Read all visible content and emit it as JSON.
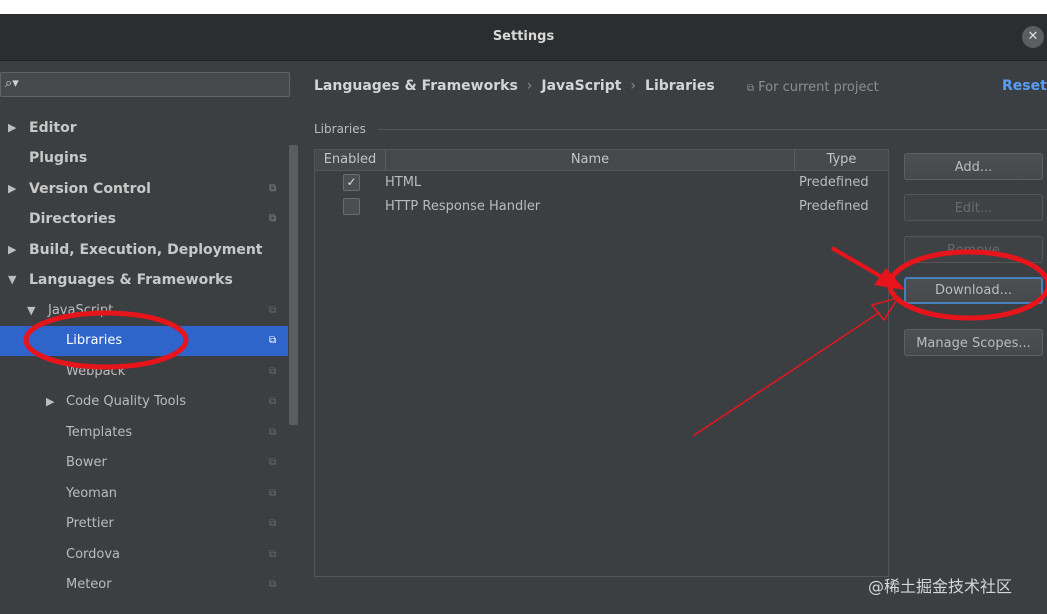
{
  "window": {
    "title": "Settings"
  },
  "search": {
    "placeholder": "",
    "value": ""
  },
  "sidebar": {
    "items": [
      {
        "label": "Editor",
        "arrow": "▶"
      },
      {
        "label": "Plugins",
        "arrow": ""
      },
      {
        "label": "Version Control",
        "arrow": "▶"
      },
      {
        "label": "Directories",
        "arrow": ""
      },
      {
        "label": "Build, Execution, Deployment",
        "arrow": "▶"
      },
      {
        "label": "Languages & Frameworks",
        "arrow": "▼"
      },
      {
        "label": "JavaScript",
        "arrow": "▼"
      },
      {
        "label": "Libraries",
        "arrow": ""
      },
      {
        "label": "Webpack",
        "arrow": ""
      },
      {
        "label": "Code Quality Tools",
        "arrow": "▶"
      },
      {
        "label": "Templates",
        "arrow": ""
      },
      {
        "label": "Bower",
        "arrow": ""
      },
      {
        "label": "Yeoman",
        "arrow": ""
      },
      {
        "label": "Prettier",
        "arrow": ""
      },
      {
        "label": "Cordova",
        "arrow": ""
      },
      {
        "label": "Meteor",
        "arrow": ""
      }
    ]
  },
  "breadcrumb": {
    "part1": "Languages & Frameworks",
    "part2": "JavaScript",
    "part3": "Libraries",
    "sep": "›"
  },
  "scope": {
    "label": "For current project"
  },
  "reset_label": "Reset",
  "libraries": {
    "group_label": "Libraries",
    "columns": {
      "enabled": "Enabled",
      "name": "Name",
      "type": "Type"
    },
    "rows": [
      {
        "checked": "✓",
        "name": "HTML",
        "type": "Predefined"
      },
      {
        "checked": "",
        "name": "HTTP Response Handler",
        "type": "Predefined"
      }
    ]
  },
  "buttons": {
    "add": "Add...",
    "edit": "Edit...",
    "remove": "Remove",
    "download": "Download...",
    "manage_scopes": "Manage Scopes..."
  },
  "watermark": "@稀土掘金技术社区",
  "icons": {
    "search": "search-icon",
    "close": "close-icon",
    "project": "project-scope-icon"
  },
  "colors": {
    "selection": "#2f65ca",
    "link": "#589df6",
    "annotation": "#e8141c"
  }
}
